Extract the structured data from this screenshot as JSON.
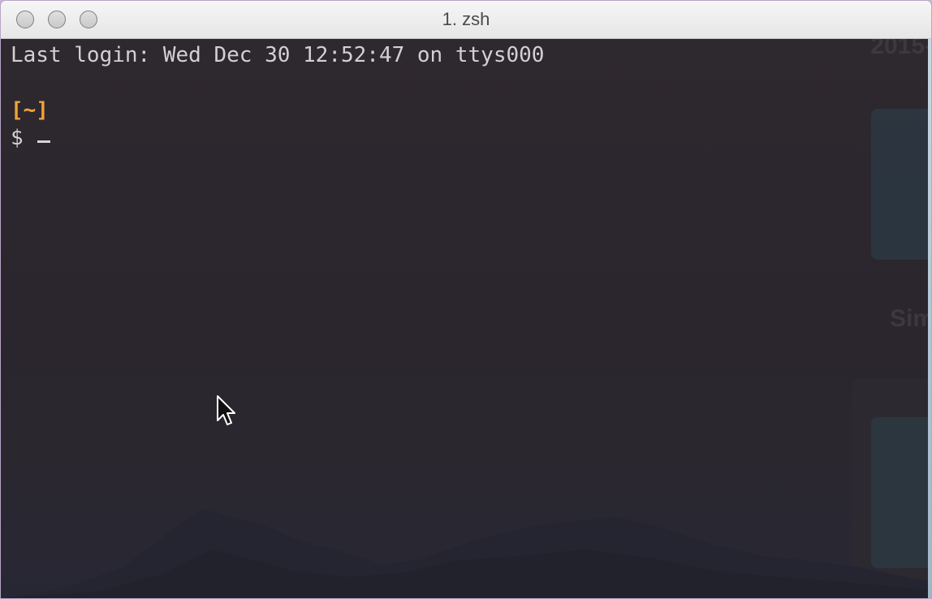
{
  "window": {
    "title": "1. zsh"
  },
  "terminal": {
    "lines": {
      "last_login": "Last login: Wed Dec 30 12:52:47 on ttys000",
      "cwd": "[~]",
      "prompt": "$ "
    }
  },
  "desktop": {
    "year_text": "2015-",
    "sim_text": "Sim"
  },
  "colors": {
    "background": "#2c262c",
    "text": "#d4d0d2",
    "cwd": "#f0a33a",
    "titlebar": "#ececec"
  },
  "icons": {
    "close": "close-icon",
    "minimize": "minimize-icon",
    "zoom": "zoom-icon",
    "pointer": "mouse-pointer-icon"
  }
}
